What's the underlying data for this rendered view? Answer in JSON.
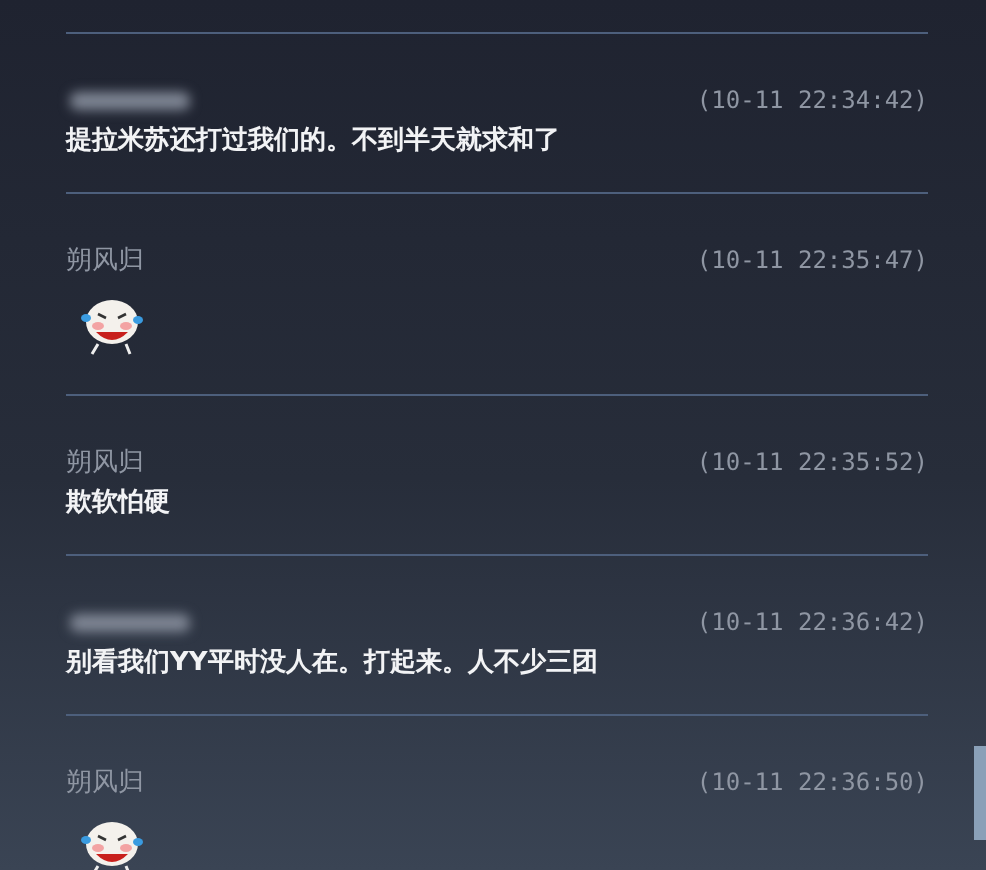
{
  "messages": [
    {
      "sender_hidden": true,
      "time": "(10-11 22:34:42)",
      "kind": "text",
      "text": "提拉米苏还打过我们的。不到半天就求和了"
    },
    {
      "sender": "朔风归",
      "time": "(10-11 22:35:47)",
      "kind": "sticker"
    },
    {
      "sender": "朔风归",
      "time": "(10-11 22:35:52)",
      "kind": "text",
      "text": "欺软怕硬"
    },
    {
      "sender_hidden": true,
      "time": "(10-11 22:36:42)",
      "kind": "text",
      "text": "别看我们YY平时没人在。打起来。人不少三团"
    },
    {
      "sender": "朔风归",
      "time": "(10-11 22:36:50)",
      "kind": "sticker"
    }
  ]
}
